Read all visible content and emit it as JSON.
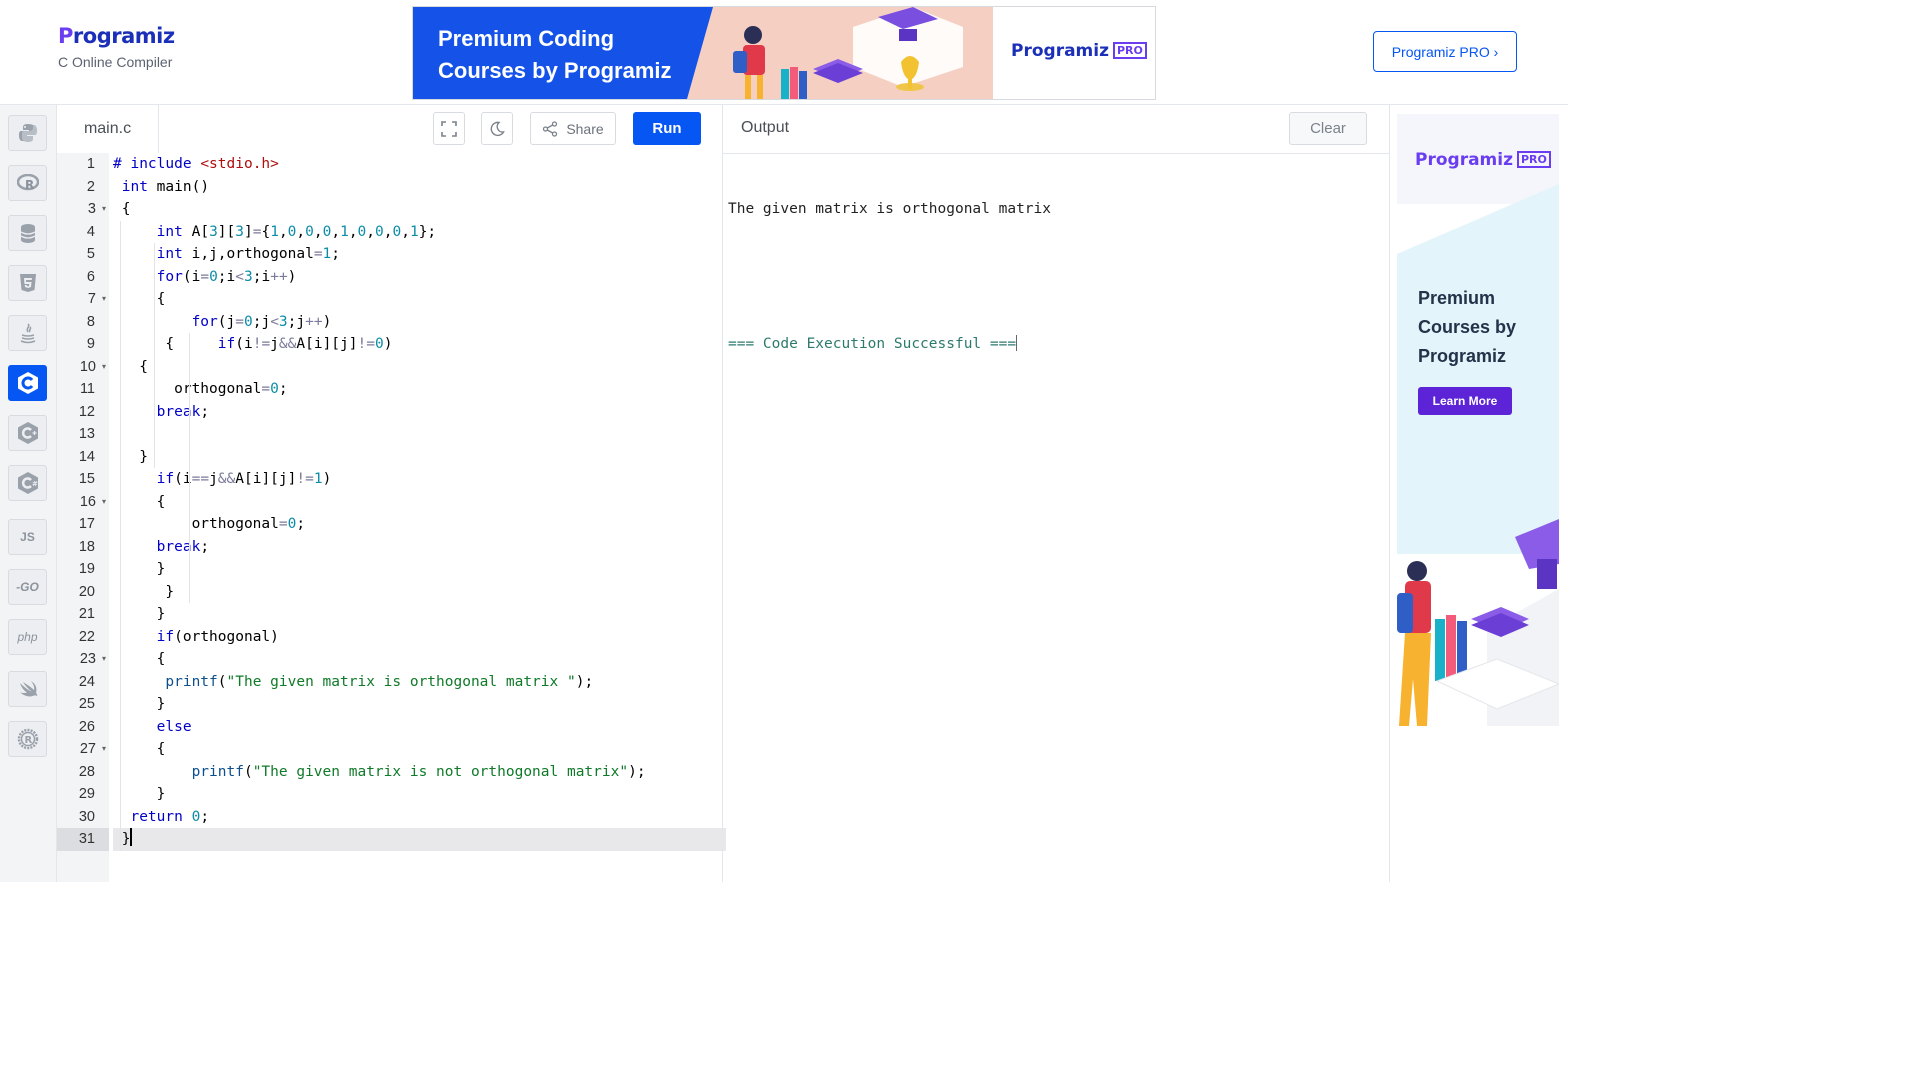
{
  "header": {
    "logo_text": "rogramiz",
    "logo_initial": "P",
    "subtitle": "C Online Compiler",
    "banner_line1": "Premium Coding",
    "banner_line2": "Courses by Programiz",
    "banner_logo": "Programiz",
    "banner_badge": "PRO",
    "pro_button": "Programiz PRO ›"
  },
  "sidebar": {
    "items": [
      {
        "name": "python"
      },
      {
        "name": "r"
      },
      {
        "name": "sql"
      },
      {
        "name": "html"
      },
      {
        "name": "java"
      },
      {
        "name": "c",
        "active": true
      },
      {
        "name": "cpp"
      },
      {
        "name": "csharp"
      },
      {
        "name": "js",
        "label": "JS"
      },
      {
        "name": "go",
        "label": "-GO"
      },
      {
        "name": "php",
        "label": "php"
      },
      {
        "name": "swift"
      },
      {
        "name": "rust"
      }
    ]
  },
  "editor": {
    "filename": "main.c",
    "share_label": "Share",
    "run_label": "Run",
    "lines": [
      "# include <stdio.h>",
      " int main()",
      " {",
      "     int A[3][3]={1,0,0,0,1,0,0,0,1};",
      "     int i,j,orthogonal=1;",
      "     for(i=0;i<3;i++)",
      "     {",
      "         for(j=0;j<3;j++)",
      "      {     if(i!=j&&A[i][j]!=0)",
      "   {",
      "       orthogonal=0;",
      "     break;",
      "",
      "   }",
      "     if(i==j&&A[i][j]!=1)",
      "     {",
      "         orthogonal=0;",
      "     break;",
      "     }",
      "      }",
      "     }",
      "     if(orthogonal)",
      "     {",
      "      printf(\"The given matrix is orthogonal matrix \");",
      "     }",
      "     else",
      "     {",
      "         printf(\"The given matrix is not orthogonal matrix\");",
      "     }",
      "  return 0;",
      " }"
    ],
    "folds": [
      3,
      7,
      10,
      16,
      23,
      27
    ]
  },
  "output": {
    "title": "Output",
    "clear_label": "Clear",
    "lines": [
      "The given matrix is orthogonal matrix",
      "",
      "=== Code Execution Successful ==="
    ]
  },
  "ad": {
    "logo": "Programiz",
    "badge": "PRO",
    "heading_line1": "Premium",
    "heading_line2": "Courses by",
    "heading_line3": "Programiz",
    "button": "Learn More"
  },
  "colors": {
    "accent": "#0556f3",
    "brand_text": "#1b2fb8",
    "brand_purple": "#6a3df0"
  }
}
